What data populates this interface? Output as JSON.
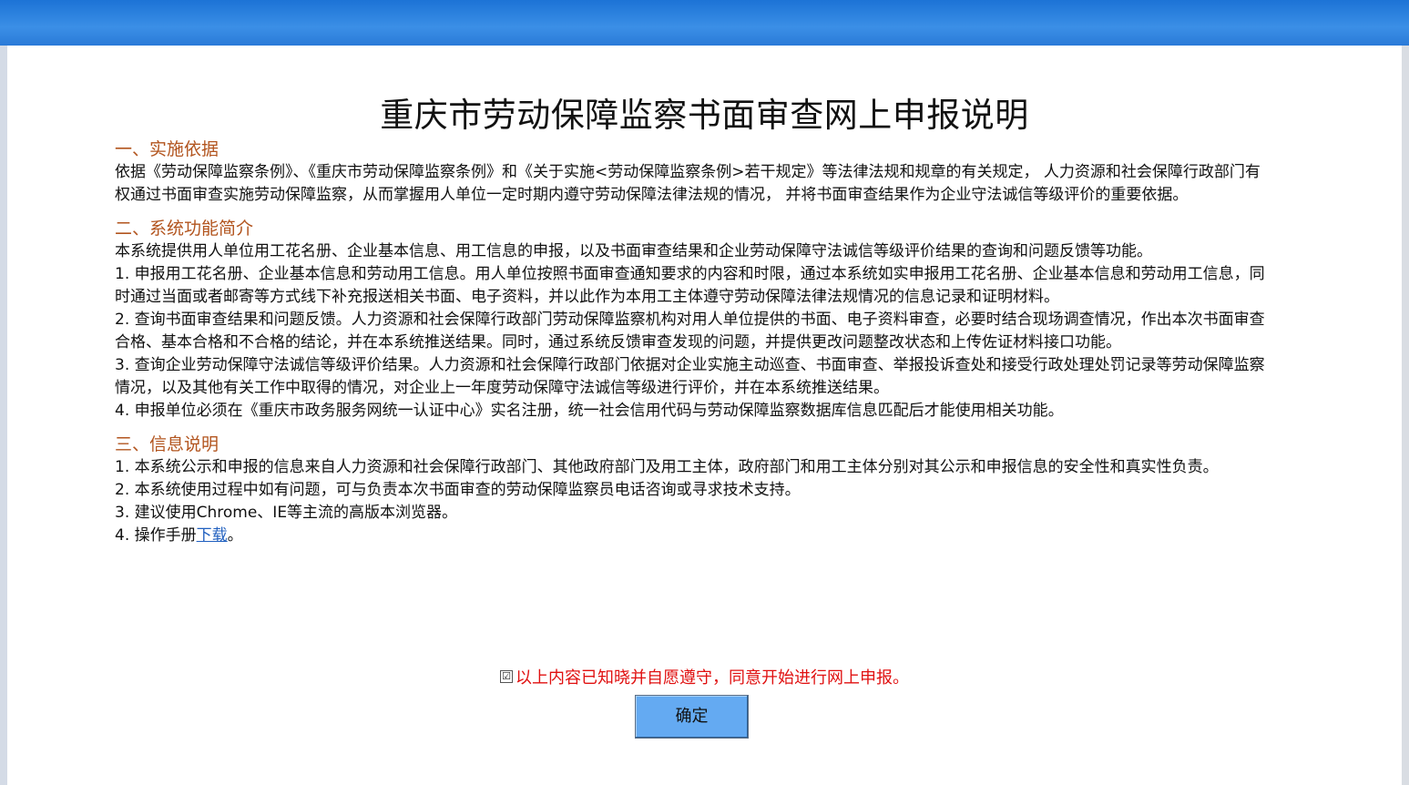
{
  "title": "重庆市劳动保障监察书面审查网上申报说明",
  "sections": [
    {
      "heading": "一、实施依据",
      "paragraphs": [
        "依据《劳动保障监察条例》、《重庆市劳动保障监察条例》和《关于实施<劳动保障监察条例>若干规定》等法律法规和规章的有关规定， 人力资源和社会保障行政部门有权通过书面审查实施劳动保障监察，从而掌握用人单位一定时期内遵守劳动保障法律法规的情况， 并将书面审查结果作为企业守法诚信等级评价的重要依据。"
      ]
    },
    {
      "heading": "二、系统功能简介",
      "paragraphs": [
        "本系统提供用人单位用工花名册、企业基本信息、用工信息的申报，以及书面审查结果和企业劳动保障守法诚信等级评价结果的查询和问题反馈等功能。",
        "1. 申报用工花名册、企业基本信息和劳动用工信息。用人单位按照书面审查通知要求的内容和时限，通过本系统如实申报用工花名册、企业基本信息和劳动用工信息，同时通过当面或者邮寄等方式线下补充报送相关书面、电子资料，并以此作为本用工主体遵守劳动保障法律法规情况的信息记录和证明材料。",
        "2. 查询书面审查结果和问题反馈。人力资源和社会保障行政部门劳动保障监察机构对用人单位提供的书面、电子资料审查，必要时结合现场调查情况，作出本次书面审查合格、基本合格和不合格的结论，并在本系统推送结果。同时，通过系统反馈审查发现的问题，并提供更改问题整改状态和上传佐证材料接口功能。",
        "3. 查询企业劳动保障守法诚信等级评价结果。人力资源和社会保障行政部门依据对企业实施主动巡查、书面审查、举报投诉查处和接受行政处理处罚记录等劳动保障监察情况，以及其他有关工作中取得的情况，对企业上一年度劳动保障守法诚信等级进行评价，并在本系统推送结果。",
        "4. 申报单位必须在《重庆市政务服务网统一认证中心》实名注册，统一社会信用代码与劳动保障监察数据库信息匹配后才能使用相关功能。"
      ]
    },
    {
      "heading": "三、信息说明",
      "paragraphs": [
        "1. 本系统公示和申报的信息来自人力资源和社会保障行政部门、其他政府部门及用工主体，政府部门和用工主体分别对其公示和申报信息的安全性和真实性负责。",
        "2. 本系统使用过程中如有问题，可与负责本次书面审查的劳动保障监察员电话咨询或寻求技术支持。",
        "3. 建议使用Chrome、IE等主流的高版本浏览器。"
      ],
      "manual_prefix": "4. 操作手册",
      "manual_link": "下载",
      "manual_suffix": "。"
    }
  ],
  "agree_checkbox_mark": "☑",
  "agree_text": "以上内容已知晓并自愿遵守，同意开始进行网上申报。",
  "confirm_label": "确定"
}
